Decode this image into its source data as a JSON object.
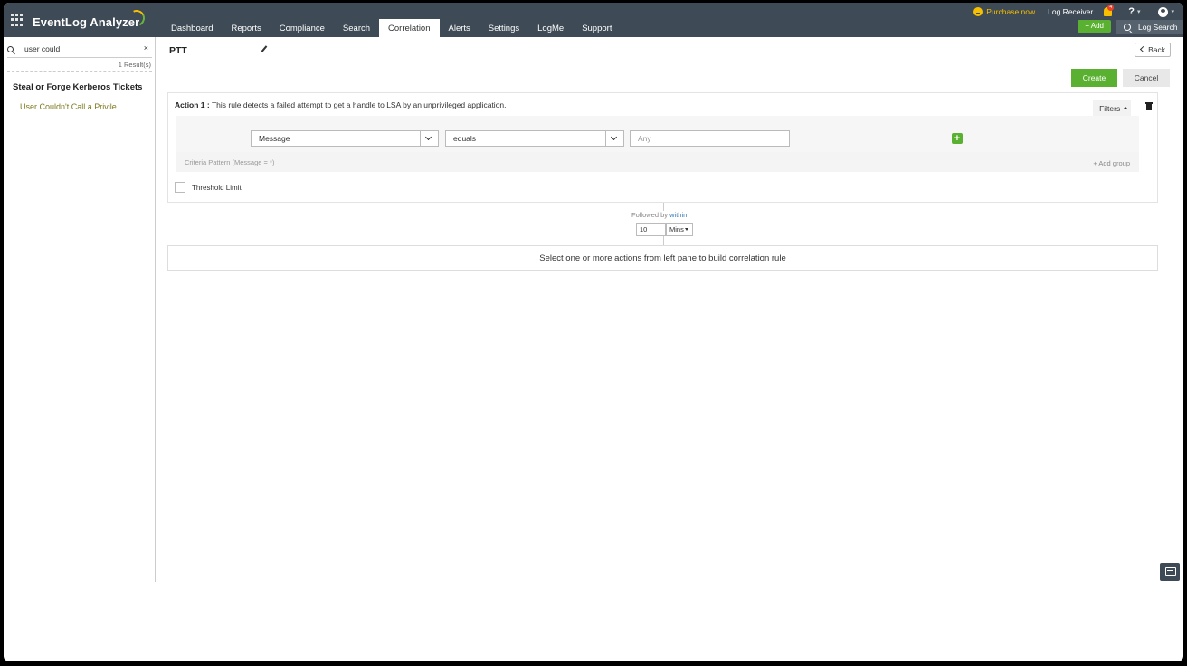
{
  "header": {
    "brand": "EventLog Analyzer",
    "tabs": [
      {
        "label": "Dashboard"
      },
      {
        "label": "Reports"
      },
      {
        "label": "Compliance"
      },
      {
        "label": "Search"
      },
      {
        "label": "Correlation",
        "active": true
      },
      {
        "label": "Alerts"
      },
      {
        "label": "Settings"
      },
      {
        "label": "LogMe"
      },
      {
        "label": "Support"
      }
    ],
    "purchase_label": "Purchase now",
    "log_receiver_label": "Log Receiver",
    "alert_badge": "4",
    "help_label": "?",
    "add_label": "+ Add",
    "log_search_label": "Log Search"
  },
  "left_pane": {
    "search_value": "user could",
    "clear_label": "×",
    "result_count": "1 Result(s)",
    "category": "Steal or Forge Kerberos Tickets",
    "items": [
      {
        "label": "User Couldn't Call a Privile..."
      }
    ]
  },
  "rule": {
    "title": "PTT",
    "back_label": "Back",
    "create_label": "Create",
    "cancel_label": "Cancel",
    "action": {
      "title_prefix": "Action 1 :",
      "description": " This rule detects a failed attempt to get a handle to LSA by an unprivileged application.",
      "filters_label": "Filters",
      "field_value": "Message",
      "operator_value": "equals",
      "value_placeholder": "Any",
      "criteria_pattern": "Criteria Pattern (Message = *)",
      "add_group_label": "+ Add group",
      "threshold_label": "Threshold Limit"
    },
    "followed": {
      "prefix": "Followed by ",
      "within": "within",
      "value": "10",
      "unit": "Mins"
    },
    "empty_message": "Select one or more actions from left pane to build correlation rule"
  },
  "colors": {
    "header_bg": "#3e4a55",
    "accent_green": "#5ab031",
    "purchase_yellow": "#f6c000"
  }
}
